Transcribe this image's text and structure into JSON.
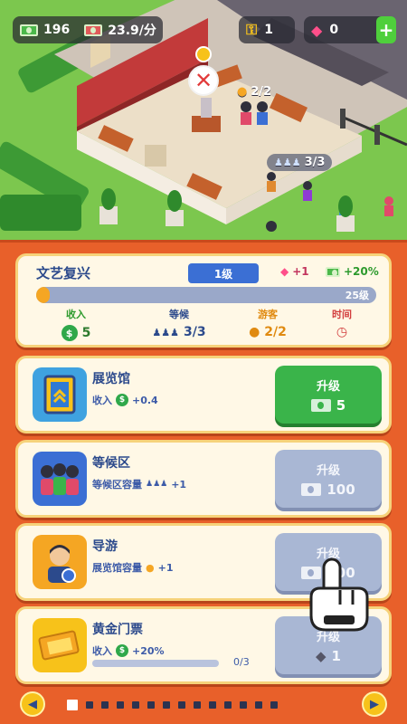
{
  "hud": {
    "money": "196",
    "income_rate": "23.9/分",
    "keys": "1",
    "gems": "0",
    "plus": "+"
  },
  "scene": {
    "guide_count": "2/2",
    "wait_count": "3/3",
    "close": "✕"
  },
  "summary": {
    "name": "文艺复兴",
    "level": "1级",
    "gem_bonus": "+1",
    "cash_bonus": "+20%",
    "progress_label": "25级",
    "progress": 0.03,
    "stats": {
      "income_label": "收入",
      "income_value": "5",
      "wait_label": "等候",
      "wait_value": "3/3",
      "guide_label": "游客",
      "guide_value": "2/2",
      "time_label": "时间"
    }
  },
  "rows": [
    {
      "title": "展览馆",
      "desc_prefix": "收入",
      "desc_suffix": "+0.4",
      "button_label": "升级",
      "cost": "5",
      "state": "active"
    },
    {
      "title": "等候区",
      "desc_prefix": "等候区容量",
      "desc_suffix": "+1",
      "button_label": "升级",
      "cost": "100",
      "state": "disabled"
    },
    {
      "title": "导游",
      "desc_prefix": "展览馆容量",
      "desc_suffix": "+1",
      "button_label": "升级",
      "cost": "200",
      "state": "disabled"
    },
    {
      "title": "黄金门票",
      "desc_prefix": "收入",
      "desc_suffix": "+20%",
      "progress_label": "0/3",
      "progress": 0,
      "button_label": "升级",
      "cost": "1",
      "state": "disabled"
    }
  ],
  "pager": {
    "prev": "◀",
    "next": "▶",
    "page_count": 14,
    "active_page": 1
  },
  "colors": {
    "panel_bg": "#e8602a",
    "card_bg": "#fff8e6",
    "accent_blue": "#2c4a8c",
    "button_green": "#3ab44a",
    "button_disabled": "#a9b7d4"
  }
}
